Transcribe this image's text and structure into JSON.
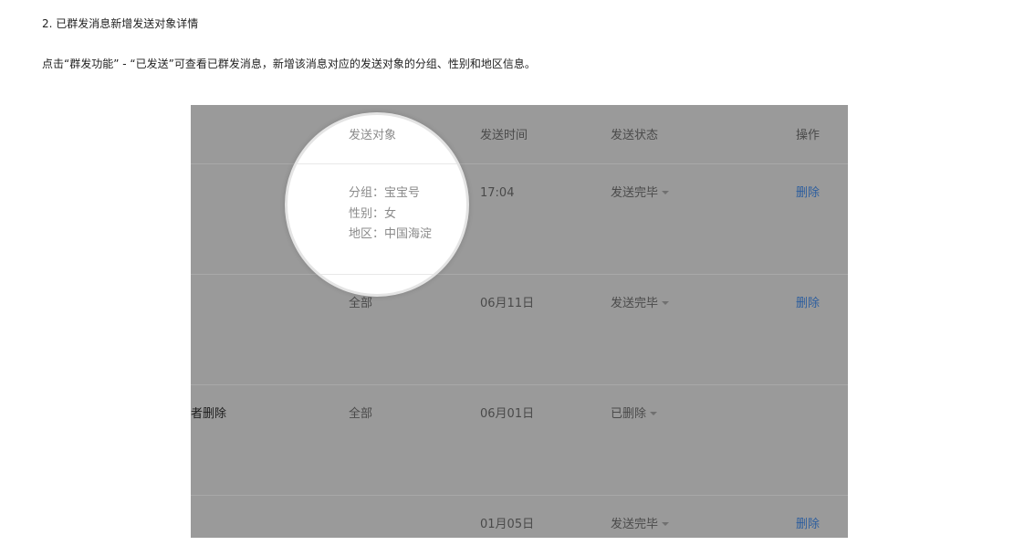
{
  "heading": "2. 已群发消息新增发送对象详情",
  "description": "点击“群发功能” - “已发送”可查看已群发消息，新增该消息对应的发送对象的分组、性别和地区信息。",
  "table": {
    "headers": {
      "target": "发送对象",
      "time": "发送时间",
      "status": "发送状态",
      "operation": "操作"
    },
    "rows": [
      {
        "name": "",
        "target_details": [
          "分组：宝宝号",
          "性别：女",
          "地区：中国海淀"
        ],
        "time": "17:04",
        "status": "发送完毕",
        "operation": "删除"
      },
      {
        "name": "",
        "target": "全部",
        "time": "06月11日",
        "status": "发送完毕",
        "operation": "删除"
      },
      {
        "name": "者删除",
        "target": "全部",
        "time": "06月01日",
        "status": "已删除",
        "operation": ""
      },
      {
        "name": "",
        "target": "",
        "time": "01月05日",
        "status": "发送完毕",
        "operation": "删除"
      }
    ]
  },
  "colors": {
    "overlay": "#9a9a9a",
    "link": "#2d5e9e",
    "lens": "#ffffff"
  },
  "icons": {
    "status_dropdown": "caret-down-icon"
  }
}
